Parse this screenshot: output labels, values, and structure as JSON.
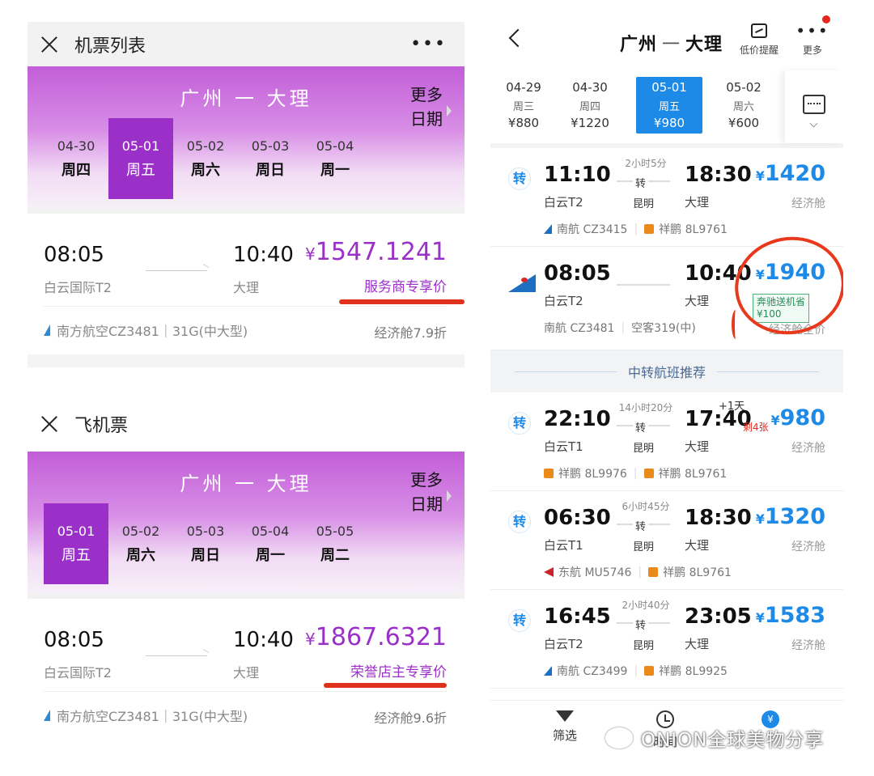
{
  "panel1": {
    "title": "机票列表",
    "menu": "•••",
    "route": "广州 一 大理",
    "dates": [
      {
        "date": "04-30",
        "day": "周四"
      },
      {
        "date": "05-01",
        "day": "周五",
        "selected": true
      },
      {
        "date": "05-02",
        "day": "周六"
      },
      {
        "date": "05-03",
        "day": "周日"
      },
      {
        "date": "05-04",
        "day": "周一"
      }
    ],
    "more_1": "更多",
    "more_2": "日期",
    "flight": {
      "dep_time": "08:05",
      "dep_airport": "白云国际T2",
      "arr_time": "10:40",
      "arr_airport": "大理",
      "price_symbol": "¥",
      "price": "1547.1241",
      "price_tag": "服务商专享价",
      "airline": "南方航空CZ3481｜31G(中大型)",
      "cabin": "经济舱7.9折"
    }
  },
  "panel2": {
    "title": "飞机票",
    "route": "广州 一 大理",
    "dates": [
      {
        "date": "05-01",
        "day": "周五",
        "selected": true
      },
      {
        "date": "05-02",
        "day": "周六"
      },
      {
        "date": "05-03",
        "day": "周日"
      },
      {
        "date": "05-04",
        "day": "周一"
      },
      {
        "date": "05-05",
        "day": "周二"
      }
    ],
    "more_1": "更多",
    "more_2": "日期",
    "flight": {
      "dep_time": "08:05",
      "dep_airport": "白云国际T2",
      "arr_time": "10:40",
      "arr_airport": "大理",
      "price_symbol": "¥",
      "price": "1867.6321",
      "price_tag": "荣誉店主专享价",
      "airline": "南方航空CZ3481｜31G(中大型)",
      "cabin": "经济舱9.6折"
    }
  },
  "panel3": {
    "route_from": "广州",
    "route_dash": "一",
    "route_to": "大理",
    "alert_label": "低价提醒",
    "more_dots": "•••",
    "more_label": "更多",
    "dates": [
      {
        "date": "04-29",
        "day": "周三",
        "price": "¥880"
      },
      {
        "date": "04-30",
        "day": "周四",
        "price": "¥1220"
      },
      {
        "date": "05-01",
        "day": "周五",
        "price": "¥980",
        "selected": true
      },
      {
        "date": "05-02",
        "day": "周六",
        "price": "¥600"
      }
    ],
    "flights": [
      {
        "transfer": "转",
        "dep": "11:10",
        "dep_ap": "白云T2",
        "duration": "2小时5分",
        "stop_label": "转",
        "stop_city": "昆明",
        "arr": "18:30",
        "arr_ap": "大理",
        "price_symbol": "¥",
        "price": "1420",
        "cabin": "经济舱",
        "airline1": "南航 CZ3415",
        "airline2": "祥鹏 8L9761"
      },
      {
        "dep": "08:05",
        "dep_ap": "白云T2",
        "arr": "10:40",
        "arr_ap": "大理",
        "price_symbol": "¥",
        "price": "1940",
        "badge_1": "奔驰送机省",
        "badge_2": "¥100",
        "cabin": "经济舱全价",
        "airline1": "南航 CZ3481",
        "airline2": "空客319(中)"
      }
    ],
    "divider": "中转航班推荐",
    "transfers": [
      {
        "transfer": "转",
        "dep": "22:10",
        "dep_ap": "白云T1",
        "duration": "14小时20分",
        "stop_label": "转",
        "stop_city": "昆明",
        "arr": "17:40",
        "plus": "+1天",
        "arr_ap": "大理",
        "left": "剩4张",
        "price_symbol": "¥",
        "price": "980",
        "cabin": "经济舱",
        "airline1": "祥鹏 8L9976",
        "airline2": "祥鹏 8L9761"
      },
      {
        "transfer": "转",
        "dep": "06:30",
        "dep_ap": "白云T1",
        "duration": "6小时45分",
        "stop_label": "转",
        "stop_city": "昆明",
        "arr": "18:30",
        "arr_ap": "大理",
        "price_symbol": "¥",
        "price": "1320",
        "cabin": "经济舱",
        "airline1": "东航 MU5746",
        "airline2": "祥鹏 8L9761"
      },
      {
        "transfer": "转",
        "dep": "16:45",
        "dep_ap": "白云T2",
        "duration": "2小时40分",
        "stop_label": "转",
        "stop_city": "昆明",
        "arr": "23:05",
        "arr_ap": "大理",
        "price_symbol": "¥",
        "price": "1583",
        "cabin": "经济舱",
        "airline1": "南航 CZ3499",
        "airline2": "祥鹏 8L9925"
      }
    ],
    "footer": [
      {
        "label": "筛选",
        "icon": "filter-icon"
      },
      {
        "label": "时间",
        "icon": "clock-icon"
      },
      {
        "label": "",
        "icon": "price-icon",
        "glyph": "¥"
      }
    ]
  },
  "watermark": "ONION全球美物分享",
  "colors": {
    "purple": "#9b30c9",
    "blue": "#1e8ae8",
    "red_mark": "#e8391c"
  }
}
